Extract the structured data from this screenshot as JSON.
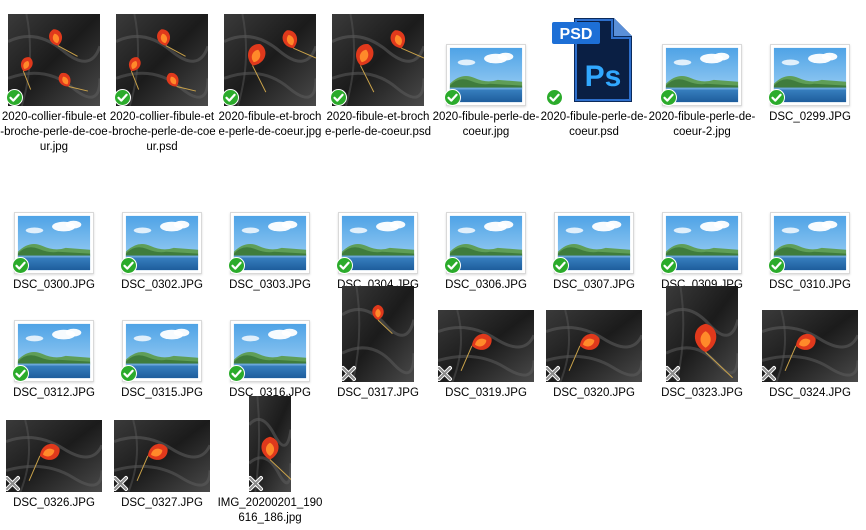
{
  "files": [
    {
      "name": "2020-collier-fibule-et-broche-perle-de-coeur.jpg",
      "thumb": "photo-bust",
      "status": "synced"
    },
    {
      "name": "2020-collier-fibule-et-broche-perle-de-coeur.psd",
      "thumb": "photo-bust",
      "status": "synced"
    },
    {
      "name": "2020-fibule-et-broche-perle-de-coeur.jpg",
      "thumb": "photo-pin",
      "status": "synced"
    },
    {
      "name": "2020-fibule-et-broche-perle-de-coeur.psd",
      "thumb": "photo-pin",
      "status": "synced"
    },
    {
      "name": "2020-fibule-perle-de-coeur.jpg",
      "thumb": "landscape",
      "status": "synced"
    },
    {
      "name": "2020-fibule-perle-de-coeur.psd",
      "thumb": "psd-icon",
      "status": "synced"
    },
    {
      "name": "2020-fibule-perle-de-coeur-2.jpg",
      "thumb": "landscape",
      "status": "synced"
    },
    {
      "name": "DSC_0299.JPG",
      "thumb": "landscape",
      "status": "synced"
    },
    {
      "name": "DSC_0300.JPG",
      "thumb": "landscape",
      "status": "synced"
    },
    {
      "name": "DSC_0302.JPG",
      "thumb": "landscape",
      "status": "synced"
    },
    {
      "name": "DSC_0303.JPG",
      "thumb": "landscape",
      "status": "synced"
    },
    {
      "name": "DSC_0304.JPG",
      "thumb": "landscape",
      "status": "synced"
    },
    {
      "name": "DSC_0306.JPG",
      "thumb": "landscape",
      "status": "synced"
    },
    {
      "name": "DSC_0307.JPG",
      "thumb": "landscape",
      "status": "synced"
    },
    {
      "name": "DSC_0309.JPG",
      "thumb": "landscape",
      "status": "synced"
    },
    {
      "name": "DSC_0310.JPG",
      "thumb": "landscape",
      "status": "synced"
    },
    {
      "name": "DSC_0312.JPG",
      "thumb": "landscape",
      "status": "synced"
    },
    {
      "name": "DSC_0315.JPG",
      "thumb": "landscape",
      "status": "synced"
    },
    {
      "name": "DSC_0316.JPG",
      "thumb": "landscape",
      "status": "synced"
    },
    {
      "name": "DSC_0317.JPG",
      "thumb": "photo-portrait",
      "status": "error"
    },
    {
      "name": "DSC_0319.JPG",
      "thumb": "photo-wide",
      "status": "error"
    },
    {
      "name": "DSC_0320.JPG",
      "thumb": "photo-wide",
      "status": "error"
    },
    {
      "name": "DSC_0323.JPG",
      "thumb": "photo-square",
      "status": "error"
    },
    {
      "name": "DSC_0324.JPG",
      "thumb": "photo-wide",
      "status": "error"
    },
    {
      "name": "DSC_0326.JPG",
      "thumb": "photo-wide",
      "status": "error"
    },
    {
      "name": "DSC_0327.JPG",
      "thumb": "photo-wide",
      "status": "error"
    },
    {
      "name": "IMG_20200201_190616_186.jpg",
      "thumb": "photo-tall",
      "status": "error"
    }
  ],
  "status_icons": {
    "synced": "green-check-icon",
    "error": "gray-x-icon"
  },
  "colors": {
    "synced": "#2bab2b",
    "error": "#8c8c8c"
  }
}
